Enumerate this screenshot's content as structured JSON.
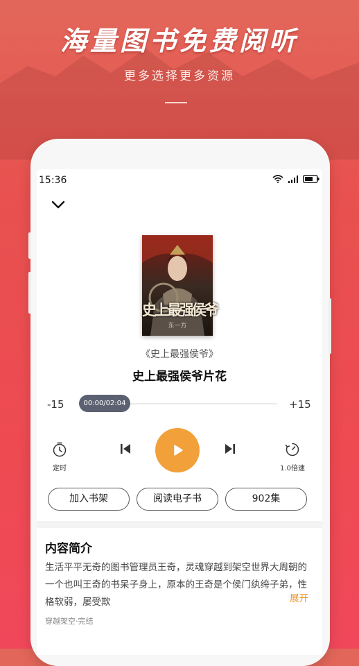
{
  "hero": {
    "title": "海量图书免费阅听",
    "subtitle": "更多选择更多资源"
  },
  "status_bar": {
    "time": "15:36",
    "icons": [
      "wifi-icon",
      "signal-icon",
      "battery-icon"
    ]
  },
  "player": {
    "book_title": "《史上最强侯爷》",
    "episode_title": "史上最强侯爷片花",
    "cover_text": "史上最强侯爷",
    "cover_author": "东一方",
    "skip_back_label": "-15",
    "skip_forward_label": "+15",
    "time_display": "00:00/02:04",
    "progress": 0,
    "timer_label": "定时",
    "speed_label": "1.0倍速"
  },
  "actions": {
    "add_shelf": "加入书架",
    "read_ebook": "阅读电子书",
    "episodes": "902集"
  },
  "intro": {
    "heading": "内容简介",
    "text": "生活平平无奇的图书管理员王奇，灵魂穿越到架空世界大周朝的一个也叫王奇的书呆子身上，原本的王奇是个侯门纨绔子弟，性格软弱，屡受欺",
    "expand_label": "展开",
    "tags": "穿越架空·完结"
  },
  "colors": {
    "background": "#ee4a52",
    "accent": "#f2a03a",
    "expand": "#e8962c",
    "progress_thumb": "#5b6170"
  }
}
